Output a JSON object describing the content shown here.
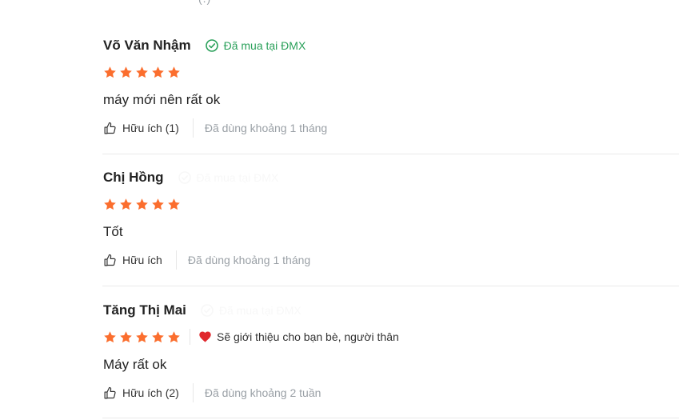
{
  "top_fragment": "(.)",
  "colors": {
    "star": "#fb6e2e",
    "verified_green": "#2aa05a",
    "heart_red": "#e0282d",
    "muted_text": "#9aa0a6"
  },
  "reviews": [
    {
      "name": "Võ Văn Nhậm",
      "badge": "Đã mua tại ĐMX",
      "rating": 5,
      "recommend": "",
      "text": "máy mới nên rất ok",
      "helpful": "Hữu ích (1)",
      "usage": "Đã dùng khoảng 1 tháng"
    },
    {
      "name": "Chị Hồng",
      "badge": "Đã mua tại ĐMX",
      "rating": 5,
      "recommend": "",
      "text": "Tốt",
      "helpful": "Hữu ích",
      "usage": "Đã dùng khoảng 1 tháng"
    },
    {
      "name": "Tăng Thị Mai",
      "badge": "Đã mua tại ĐMX",
      "rating": 5,
      "recommend": "Sẽ giới thiệu cho bạn bè, người thân",
      "text": "Máy rất ok",
      "helpful": "Hữu ích (2)",
      "usage": "Đã dùng khoảng 2 tuần"
    }
  ]
}
